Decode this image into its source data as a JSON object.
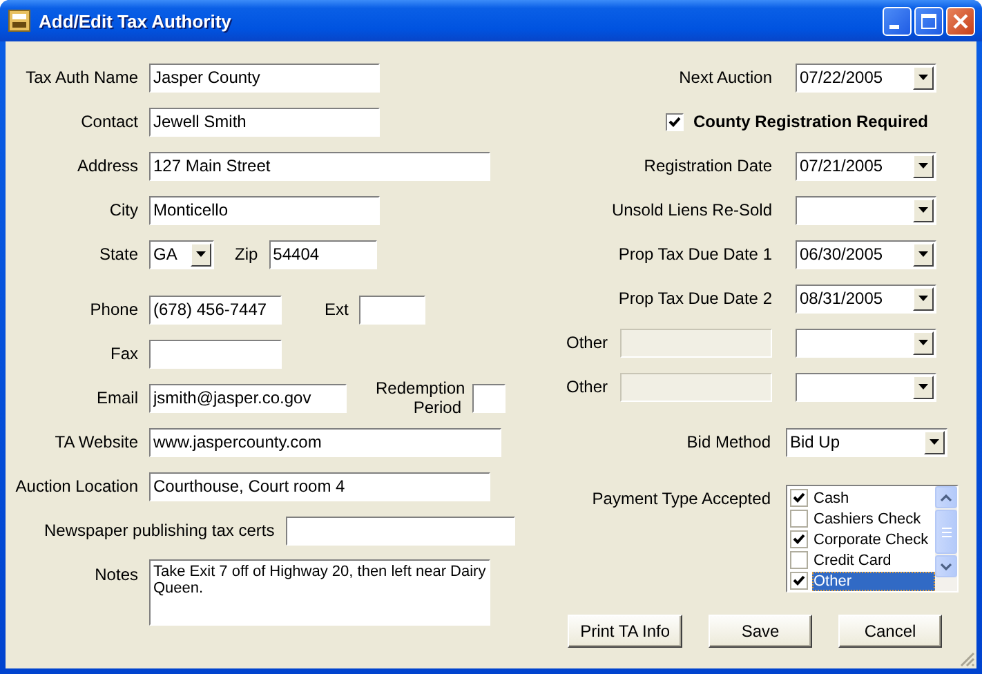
{
  "window": {
    "title": "Add/Edit Tax Authority"
  },
  "left_rows": [
    {
      "fields": [
        {
          "label": "Tax Auth Name",
          "kind": "text",
          "value": "Jasper County"
        }
      ]
    },
    {
      "fields": [
        {
          "label": "Contact",
          "kind": "text",
          "value": "Jewell Smith"
        }
      ]
    },
    {
      "fields": [
        {
          "label": "Address",
          "kind": "text",
          "value": "127 Main Street"
        }
      ]
    },
    {
      "fields": [
        {
          "label": "City",
          "kind": "text",
          "value": "Monticello"
        }
      ]
    },
    {
      "fields": [
        {
          "label": "State",
          "kind": "combo",
          "value": "GA"
        },
        {
          "label": "Zip",
          "kind": "text",
          "value": "54404"
        }
      ]
    },
    {
      "fields": [
        {
          "label": "Phone",
          "kind": "text",
          "value": "(678) 456-7447"
        },
        {
          "label": "Ext",
          "kind": "text"
        }
      ]
    },
    {
      "fields": [
        {
          "label": "Fax",
          "kind": "text"
        }
      ]
    },
    {
      "fields": [
        {
          "label": "Email",
          "kind": "text",
          "value": "jsmith@jasper.co.gov"
        },
        {
          "label": "Redemption Period",
          "kind": "text"
        }
      ]
    },
    {
      "fields": [
        {
          "label": "TA Website",
          "kind": "text",
          "value": "www.jaspercounty.com"
        }
      ]
    },
    {
      "fields": [
        {
          "label": "Auction Location",
          "kind": "text",
          "value": "Courthouse, Court room 4"
        }
      ]
    },
    {
      "fields": [
        {
          "label": "Newspaper publishing tax certs",
          "kind": "text"
        }
      ]
    },
    {
      "fields": [
        {
          "label": "Notes",
          "kind": "textarea",
          "value": "Take Exit 7 off of Highway 20, then left near Dairy Queen."
        }
      ]
    }
  ],
  "right_rows": [
    {
      "fields": [
        {
          "label": "Next Auction",
          "kind": "combo",
          "value": "07/22/2005"
        }
      ]
    },
    {
      "fields": [
        {
          "label": "County Registration Required",
          "kind": "checkbox",
          "checked": true
        }
      ]
    },
    {
      "fields": [
        {
          "label": "Registration Date",
          "kind": "combo",
          "value": "07/21/2005"
        }
      ]
    },
    {
      "fields": [
        {
          "label": "Unsold Liens Re-Sold",
          "kind": "combo"
        }
      ]
    },
    {
      "fields": [
        {
          "label": "Prop Tax Due Date 1",
          "kind": "combo",
          "value": "06/30/2005"
        }
      ]
    },
    {
      "fields": [
        {
          "label": "Prop Tax Due Date 2",
          "kind": "combo",
          "value": "08/31/2005"
        }
      ]
    },
    {
      "fields": [
        {
          "label": "Other",
          "kind": "text",
          "disabled": true
        },
        {
          "kind": "combo"
        }
      ]
    },
    {
      "fields": [
        {
          "label": "Other",
          "kind": "text",
          "disabled": true
        },
        {
          "kind": "combo"
        }
      ]
    },
    {
      "fields": [
        {
          "label": "Bid Method",
          "kind": "combo",
          "value": "Bid Up"
        }
      ]
    }
  ],
  "payment_types": {
    "label": "Payment Type Accepted",
    "items": [
      {
        "label": "Cash",
        "checked": true,
        "selected": false
      },
      {
        "label": "Cashiers Check",
        "checked": false,
        "selected": false
      },
      {
        "label": "Corporate Check",
        "checked": true,
        "selected": false
      },
      {
        "label": "Credit Card",
        "checked": false,
        "selected": false
      },
      {
        "label": "Other",
        "checked": true,
        "selected": true
      }
    ]
  },
  "buttons": [
    "Print TA Info",
    "Save",
    "Cancel"
  ]
}
